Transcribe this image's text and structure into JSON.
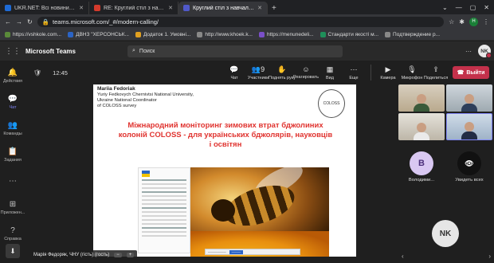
{
  "browser": {
    "tabs": [
      {
        "label": "UKR.NET: Всі новини України, о...",
        "color": "#1e6bd6",
        "active": false
      },
      {
        "label": "RE: Круглий стіл з навчальним...",
        "color": "#d33a2c",
        "active": false
      },
      {
        "label": "Круглий стіл з навчальними...",
        "color": "#5059c9",
        "active": true
      }
    ],
    "url": "teams.microsoft.com/_#/modern-calling/",
    "profile_initial": "H",
    "bookmarks": [
      {
        "label": "https://vshkole.com...",
        "color": "#5a8a3a"
      },
      {
        "label": "ДВНЗ \"ХЕРСОНСЬК...",
        "color": "#2b64c6"
      },
      {
        "label": "Додаток 1. Умовні...",
        "color": "#e0a020"
      },
      {
        "label": "http://www.khoek.k...",
        "color": "#888888"
      },
      {
        "label": "https://menunedeli...",
        "color": "#7a4fc8"
      },
      {
        "label": "Стандарти якості м...",
        "color": "#1f8f5a"
      },
      {
        "label": "Подтверждение р...",
        "color": "#888888"
      }
    ]
  },
  "teams": {
    "title": "Microsoft Teams",
    "search_placeholder": "Поиск",
    "user_initials": "NK"
  },
  "rail": [
    {
      "label": "Действия",
      "icon": "bell-icon",
      "active": false
    },
    {
      "label": "Чат",
      "icon": "chat-icon",
      "active": true
    },
    {
      "label": "Команды",
      "icon": "teams-icon",
      "active": false
    },
    {
      "label": "Задания",
      "icon": "assignments-icon",
      "active": false
    },
    {
      "label": "Приложен...",
      "icon": "apps-icon",
      "active": false
    },
    {
      "label": "Справка",
      "icon": "help-icon",
      "active": false
    }
  ],
  "meeting": {
    "timer": "12:45",
    "controls": [
      {
        "label": "Чат",
        "icon": "chat-icon",
        "glyph": "💬"
      },
      {
        "label": "Участники",
        "icon": "participants-icon",
        "glyph": "👥9"
      },
      {
        "label": "Поднять руку",
        "icon": "raise-hand-icon",
        "glyph": "✋"
      },
      {
        "label": "Реагировать",
        "icon": "react-icon",
        "glyph": "☺"
      },
      {
        "label": "Вид",
        "icon": "view-icon",
        "glyph": "▦"
      },
      {
        "label": "Еще",
        "icon": "more-icon",
        "glyph": "⋯"
      }
    ],
    "media": [
      {
        "label": "Камера",
        "icon": "camera-icon",
        "glyph": "▶"
      },
      {
        "label": "Микрофон",
        "icon": "mic-off-icon",
        "glyph": "🎙"
      },
      {
        "label": "Поделиться",
        "icon": "share-icon",
        "glyph": "⇪"
      }
    ],
    "leave_label": "Выйти"
  },
  "slide": {
    "presenter_name": "Mariia Fedoriak",
    "presenter_line2": "Yuriy Fedkovych Chernivtsi National University,",
    "presenter_line3": "Ukraine National Coordinator",
    "presenter_line4": "of COLOSS  survey",
    "title": "Міжнародний моніторинг зимових втрат бджолиних колоній COLOSS - для українських бджолярів, науковців і освітян",
    "logo_text": "COLOSS"
  },
  "stage": {
    "presenter_label": "Марія Федоряк, ЧНУ (гість) (гость)"
  },
  "participants": [
    {
      "initial": "B",
      "name": "Володими..."
    },
    {
      "initial": "👁",
      "name": "Увидеть всех"
    },
    {
      "initial": "NK",
      "name": ""
    }
  ],
  "colors": {
    "accent": "#7f85f5",
    "leave": "#c4314b",
    "slide_title": "#e0332f"
  }
}
